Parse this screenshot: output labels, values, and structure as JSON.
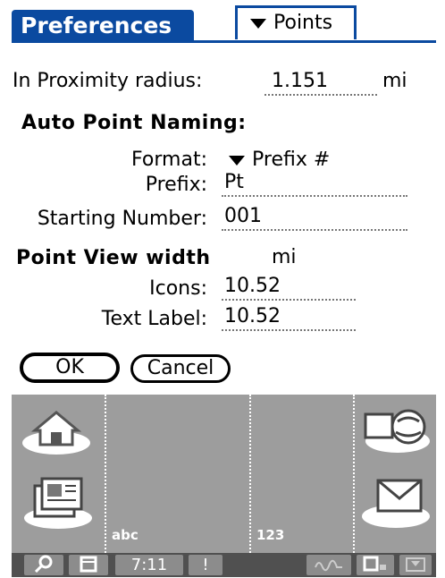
{
  "title": "Preferences",
  "category_menu": {
    "label": "Points"
  },
  "proximity": {
    "label": "In Proximity radius:",
    "value": "1.151",
    "unit": "mi"
  },
  "auto_naming": {
    "heading": "Auto Point Naming:",
    "format_label": "Format:",
    "format_value": "Prefix #",
    "prefix_label": "Prefix:",
    "prefix_value": "Pt",
    "start_label": "Starting Number:",
    "start_value": "001"
  },
  "view_width": {
    "heading": "Point View width",
    "unit": "mi",
    "icons_label": "Icons:",
    "icons_value": "10.52",
    "text_label": "Text Label:",
    "text_value": "10.52"
  },
  "buttons": {
    "ok": "OK",
    "cancel": "Cancel"
  },
  "graffiti": {
    "alpha_label": "abc",
    "numeric_label": "123"
  },
  "statusbar": {
    "time": "7:11",
    "alert": "!"
  },
  "colors": {
    "title_bg": "#0b4aa0",
    "silk_bg": "#9d9d9d",
    "statusbar_bg": "#505050"
  }
}
